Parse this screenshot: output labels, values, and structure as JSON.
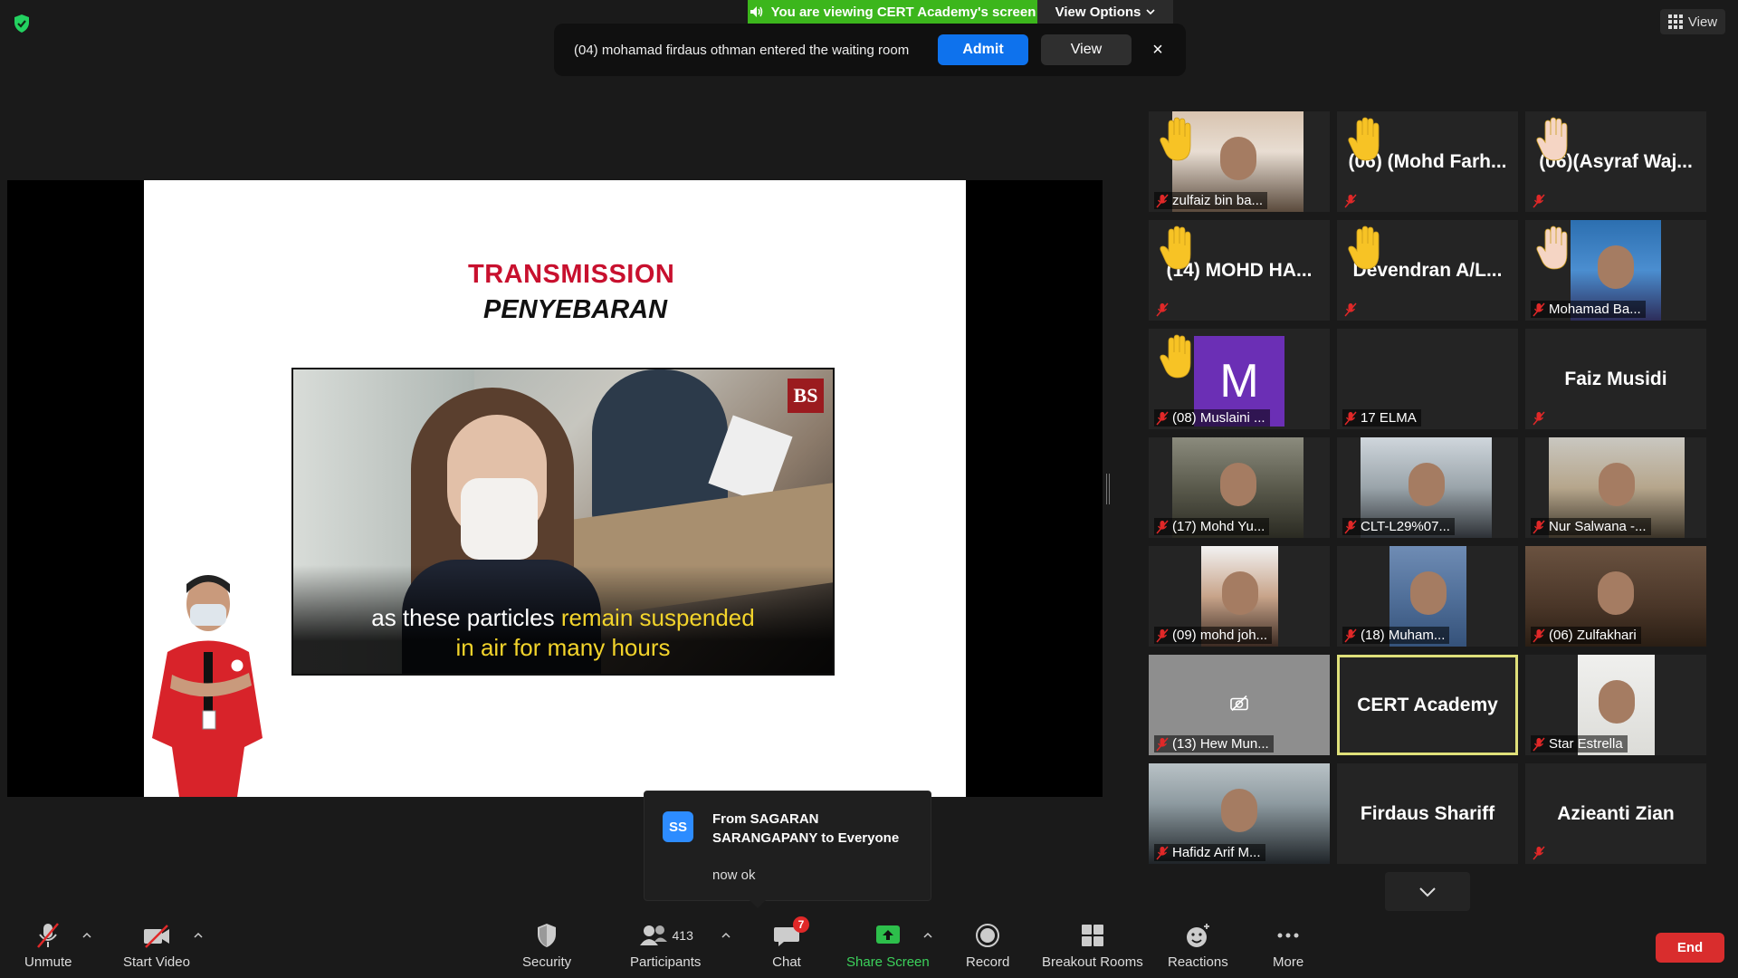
{
  "colors": {
    "accent_blue": "#0e72ed",
    "share_green": "#3cb61c",
    "end_red": "#d92d2d",
    "active_speaker_border": "#dfe07a",
    "slide_title_red": "#c8102e",
    "caption_highlight": "#f3d42b"
  },
  "top": {
    "viewing_banner": "You are viewing CERT Academy's screen",
    "view_options": "View Options",
    "view_label": "View",
    "security_icon": "shield-check-icon"
  },
  "waiting_room": {
    "message": "(04) mohamad firdaus othman entered the waiting room",
    "admit_label": "Admit",
    "view_label": "View",
    "close_label": "×"
  },
  "slide": {
    "title_en": "TRANSMISSION",
    "title_ms": "PENYEBARAN",
    "logo_text": "BS",
    "caption_normal": "as these particles ",
    "caption_highlight_1": "remain suspended",
    "caption_highlight_2": "in air for many hours"
  },
  "chat_popup": {
    "avatar_initials": "SS",
    "from": "From SAGARAN SARANGAPANY to Everyone",
    "message": "now ok"
  },
  "gallery": [
    {
      "name": "zulfaiz bin ba...",
      "muted": true,
      "hand": true,
      "video": true
    },
    {
      "name": "(06) (Mohd Farh...",
      "muted": true,
      "hand": true,
      "video": false
    },
    {
      "name": "(06)(Asyraf Waj...",
      "muted": true,
      "hand": true,
      "video": false
    },
    {
      "name": "(14) MOHD HA...",
      "muted": true,
      "hand": true,
      "video": false
    },
    {
      "name": "Devendran A/L...",
      "muted": true,
      "hand": true,
      "video": false
    },
    {
      "name": "Mohamad Ba...",
      "muted": true,
      "hand": true,
      "video": true
    },
    {
      "name": "(08) Muslaini ...",
      "muted": true,
      "hand": true,
      "avatar": "M"
    },
    {
      "name": "17 ELMA",
      "muted": true,
      "hand": false,
      "video": false
    },
    {
      "name": "Faiz Musidi",
      "muted": true,
      "hand": false,
      "video": false
    },
    {
      "name": "(17) Mohd Yu...",
      "muted": true,
      "hand": false,
      "video": true
    },
    {
      "name": "CLT-L29%07...",
      "muted": true,
      "hand": false,
      "video": true
    },
    {
      "name": "Nur Salwana -...",
      "muted": true,
      "hand": false,
      "video": true
    },
    {
      "name": "(09) mohd joh...",
      "muted": true,
      "hand": false,
      "video": true
    },
    {
      "name": "(18) Muham...",
      "muted": true,
      "hand": false,
      "video": true
    },
    {
      "name": "(06) Zulfakhari",
      "muted": true,
      "hand": false,
      "video": true
    },
    {
      "name": "(13) Hew Mun...",
      "muted": true,
      "hand": false,
      "video": false
    },
    {
      "name": "CERT Academy",
      "muted": false,
      "hand": false,
      "video": false,
      "active": true
    },
    {
      "name": "Star Estrella",
      "muted": true,
      "hand": false,
      "video": true
    },
    {
      "name": "Hafidz Arif M...",
      "muted": true,
      "hand": false,
      "video": true
    },
    {
      "name": "Firdaus Shariff",
      "muted": false,
      "hand": false,
      "video": false
    },
    {
      "name": "Azieanti Zian",
      "muted": true,
      "hand": false,
      "video": false
    }
  ],
  "toolbar": {
    "unmute": "Unmute",
    "start_video": "Start Video",
    "security": "Security",
    "participants": "Participants",
    "participants_count": "413",
    "chat": "Chat",
    "chat_badge": "7",
    "share_screen": "Share Screen",
    "record": "Record",
    "breakout_rooms": "Breakout Rooms",
    "reactions": "Reactions",
    "more": "More",
    "end": "End"
  }
}
